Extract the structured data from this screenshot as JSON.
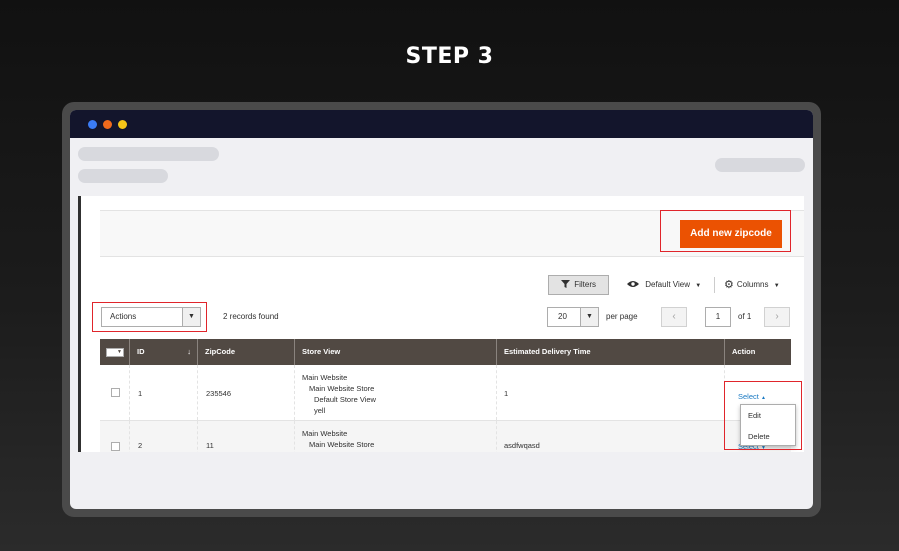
{
  "heading": "STEP 3",
  "toolbar": {
    "add_button": "Add new zipcode",
    "filters": "Filters",
    "view": "Default View",
    "columns": "Columns"
  },
  "grid_controls": {
    "actions_label": "Actions",
    "records_found": "2 records found",
    "per_page_value": "20",
    "per_page_label": "per page",
    "page_value": "1",
    "page_total": "of 1"
  },
  "table": {
    "headers": [
      "ID",
      "ZipCode",
      "Store View",
      "Estimated Delivery Time",
      "Action"
    ],
    "rows": [
      {
        "id": "1",
        "zipcode": "235546",
        "store_view": [
          "Main Website",
          "Main Website Store",
          "Default Store View",
          "yell"
        ],
        "delivery": "1",
        "action": "Select"
      },
      {
        "id": "2",
        "zipcode": "11",
        "store_view": [
          "Main Website",
          "Main Website Store"
        ],
        "delivery": "asdfwqasd",
        "action": "Select"
      }
    ]
  },
  "action_menu": {
    "items": [
      "Edit",
      "Delete"
    ]
  },
  "colors": {
    "accent": "#eb5202",
    "header_bg": "#514943",
    "highlight": "#e0252b",
    "link": "#1979c3"
  }
}
